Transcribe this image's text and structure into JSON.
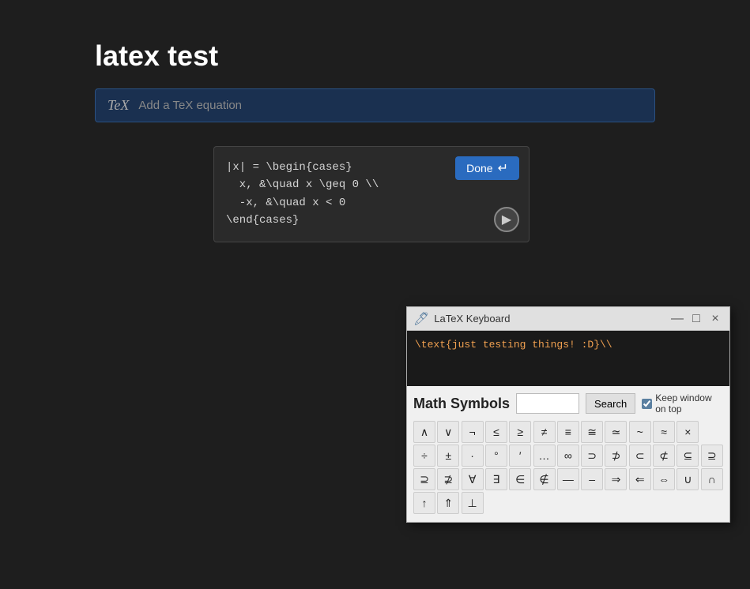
{
  "page": {
    "title": "latex test",
    "background": "#1e1e1e"
  },
  "tex_bar": {
    "logo": "TeX",
    "placeholder": "Add a TeX equation"
  },
  "equation_editor": {
    "code": "|x| = \\begin{cases}\n  x, &\\quad x \\geq 0 \\\\\n  -x, &\\quad x < 0\n\\end{cases}",
    "done_label": "Done",
    "render_icon": "▶"
  },
  "latex_keyboard": {
    "title": "LaTeX Keyboard",
    "textarea_content": "\\text{just testing things! :D}\\\\",
    "search_placeholder": "",
    "search_button_label": "Search",
    "keep_on_top_label": "Keep window on top",
    "math_symbols_label": "Math Symbols",
    "symbols_row1": [
      "∧",
      "∨",
      "¬",
      "≤",
      "≥",
      "≠",
      "≡",
      "≅",
      "≃",
      "~",
      "≈",
      "×"
    ],
    "symbols_row2": [
      "÷",
      "±",
      "·",
      "°",
      "′",
      "…",
      "∞",
      "⊃",
      "⊅",
      "⊂",
      "⊄",
      "⊆",
      "⊇"
    ],
    "symbols_row3": [
      "⊇",
      "⊉",
      "∀",
      "∃",
      "∈",
      "∉",
      "—",
      "–",
      "⇒",
      "⇐",
      "⇔",
      "∪",
      "∩"
    ],
    "symbols_row4": [
      "↑",
      "↑↑",
      "⊥"
    ],
    "titlebar_controls": {
      "minimize": "—",
      "maximize": "□",
      "close": "×"
    }
  }
}
